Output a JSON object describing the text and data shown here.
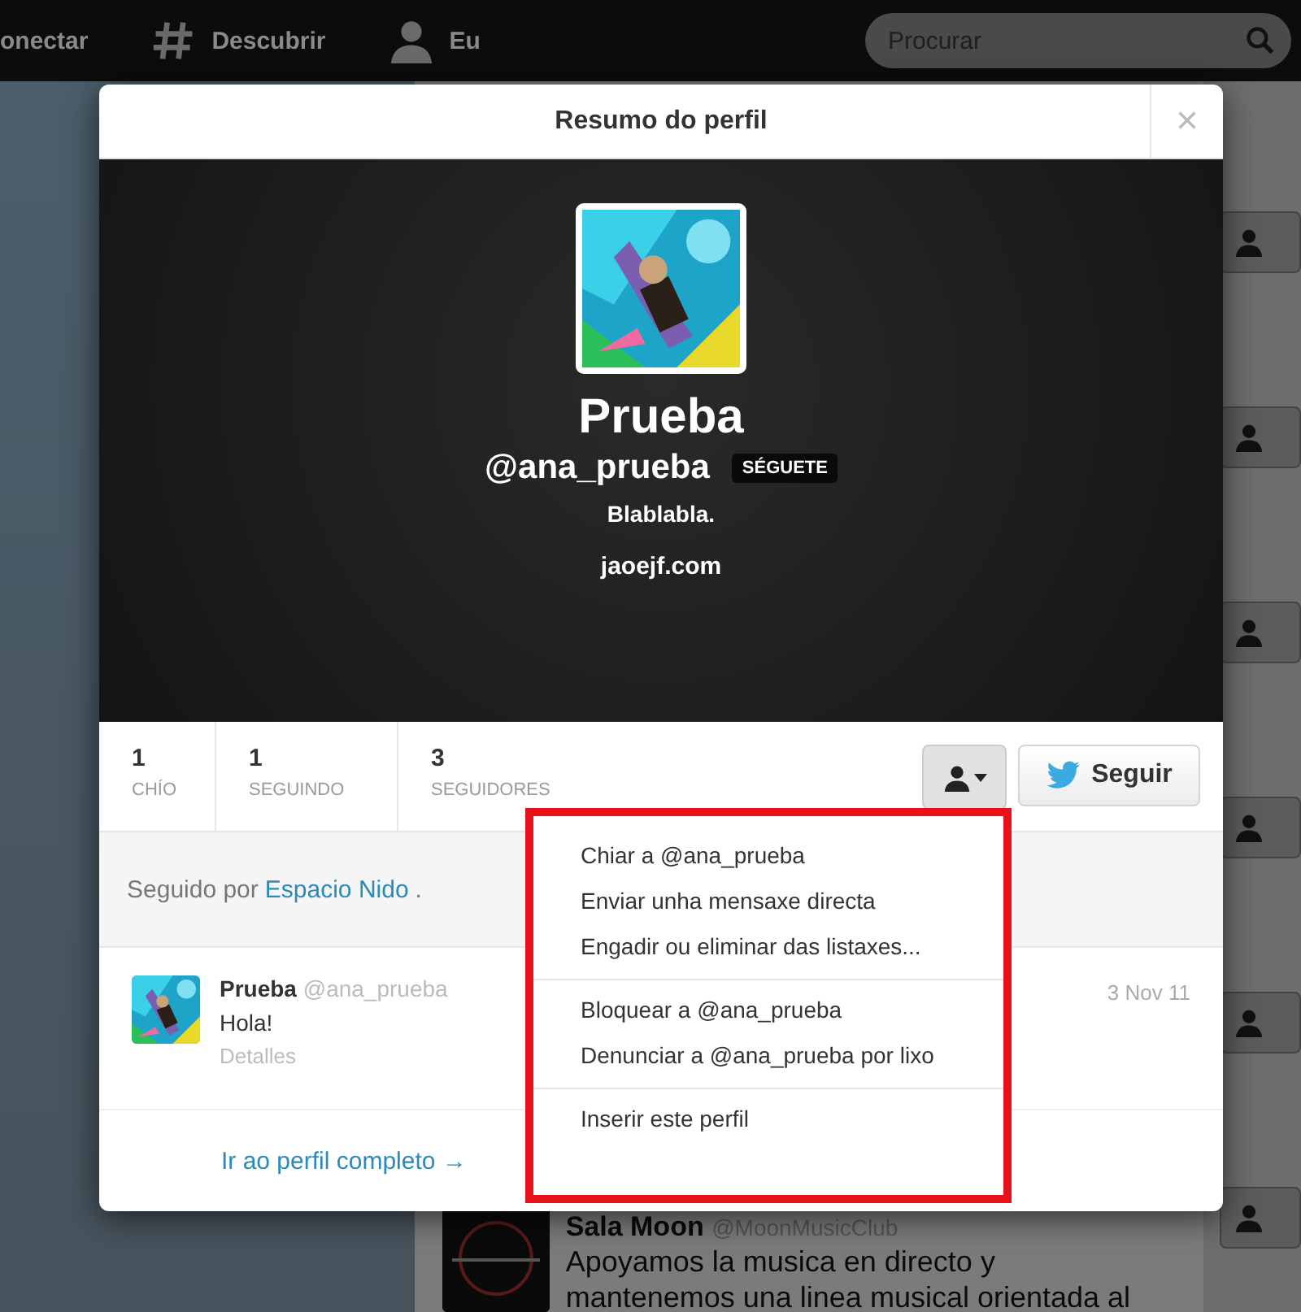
{
  "topbar": {
    "nav": [
      {
        "kind": "text",
        "label": "onectar"
      },
      {
        "kind": "hash",
        "label": "Descubrir"
      },
      {
        "kind": "person",
        "label": "Eu"
      }
    ],
    "search": {
      "placeholder": "Procurar"
    }
  },
  "stream": {
    "tweet": {
      "name": "Sala Moon",
      "handle": "@MoonMusicClub",
      "lines": [
        "Apoyamos la musica en directo y",
        "mantenemos una linea musical orientada al"
      ]
    }
  },
  "modal": {
    "title": "Resumo do perfil",
    "close": "×",
    "profile": {
      "name": "Prueba",
      "handle": "@ana_prueba",
      "badge": "SÉGUETE",
      "bio": "Blablabla.",
      "url": "jaoejf.com"
    },
    "stats": [
      {
        "value": "1",
        "label": "CHÍO"
      },
      {
        "value": "1",
        "label": "SEGUINDO"
      },
      {
        "value": "3",
        "label": "SEGUIDORES"
      }
    ],
    "follow_button": "Seguir",
    "followed_by": {
      "prefix": "Seguido por",
      "link": "Espacio Nido",
      "suffix": "."
    },
    "tweet": {
      "name": "Prueba",
      "handle": "@ana_prueba",
      "text": "Hola!",
      "details": "Detalles",
      "date": "3 Nov 11"
    },
    "full_profile_link": "Ir ao perfil completo →",
    "menu": {
      "groups": [
        [
          "Chiar a @ana_prueba",
          "Enviar unha mensaxe directa",
          "Engadir ou eliminar das listaxes..."
        ],
        [
          "Bloquear a @ana_prueba",
          "Denunciar a @ana_prueba por lixo"
        ],
        [
          "Inserir este perfil"
        ]
      ]
    }
  }
}
